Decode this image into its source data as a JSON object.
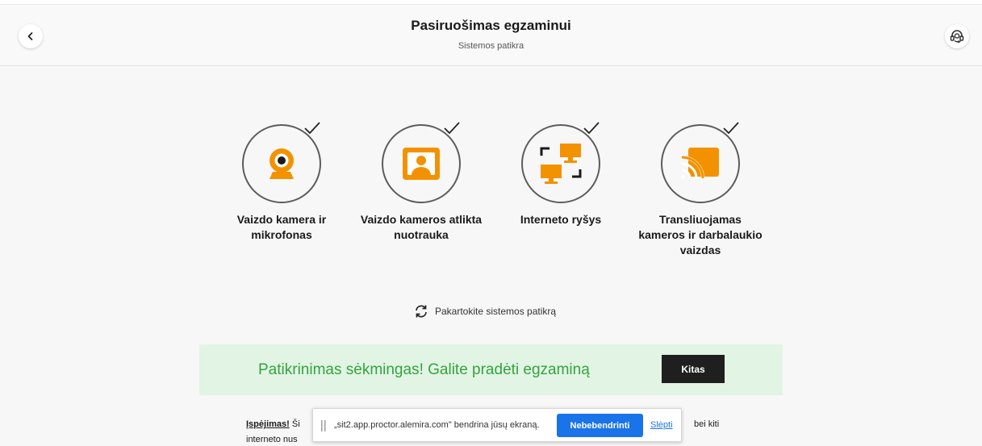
{
  "header": {
    "title": "Pasiruošimas egzaminui",
    "subtitle": "Sistemos patikra"
  },
  "checks": [
    {
      "label": "Vaizdo kamera ir mikrofonas",
      "icon": "webcam-icon",
      "status": "passed"
    },
    {
      "label": "Vaizdo kameros atlikta nuotrauka",
      "icon": "photo-icon",
      "status": "passed"
    },
    {
      "label": "Interneto ryšys",
      "icon": "network-icon",
      "status": "passed"
    },
    {
      "label": "Transliuojamas kameros ir darbalaukio vaizdas",
      "icon": "cast-icon",
      "status": "passed"
    }
  ],
  "retry_label": "Pakartokite sistemos patikrą",
  "banner": {
    "message": "Patikrinimas sėkmingas! Galite pradėti egzaminą",
    "next_label": "Kitas"
  },
  "warning": {
    "bold": "Įspėjimas!",
    "visible_start": "Ši",
    "visible_end": "bei kiti",
    "line2": "interneto nus"
  },
  "share_bar": {
    "message": "„sit2.app.proctor.alemira.com\" bendrina jūsų ekraną.",
    "stop_label": "Nebebendrinti",
    "hide_label": "Slėpti"
  },
  "colors": {
    "accent_orange": "#f39200",
    "success_green": "#34a33f",
    "banner_bg": "#e2f4e4",
    "chrome_blue": "#1a73e8"
  }
}
